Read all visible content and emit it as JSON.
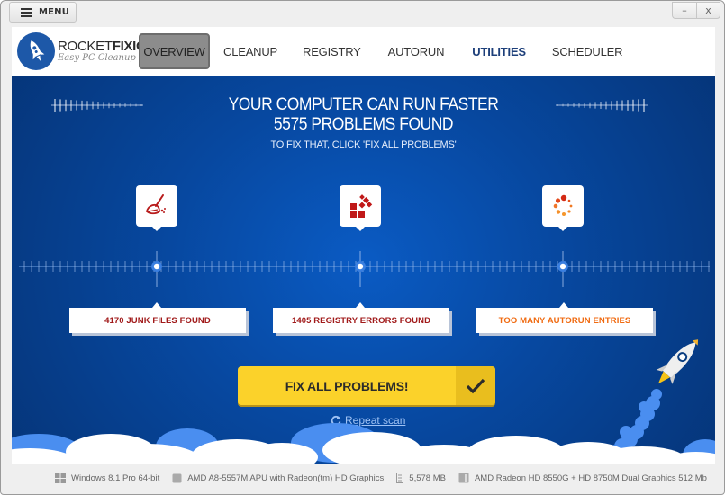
{
  "titlebar": {
    "menu_label": "MENU",
    "minimize_glyph": "–",
    "close_glyph": "x"
  },
  "brand": {
    "name_light": "ROCKET",
    "name_bold": "FIXIO",
    "tagline": "Easy PC Cleanup"
  },
  "nav": {
    "items": [
      {
        "label": "OVERVIEW",
        "state": "active"
      },
      {
        "label": "CLEANUP",
        "state": "normal"
      },
      {
        "label": "REGISTRY",
        "state": "normal"
      },
      {
        "label": "AUTORUN",
        "state": "normal"
      },
      {
        "label": "UTILITIES",
        "state": "highlight"
      },
      {
        "label": "SCHEDULER",
        "state": "normal"
      }
    ]
  },
  "headline": {
    "line1": "YOUR COMPUTER CAN RUN FASTER",
    "line2": "5575 PROBLEMS FOUND",
    "line3": "TO FIX THAT, CLICK 'FIX ALL PROBLEMS'"
  },
  "results": [
    {
      "icon": "broom-icon",
      "label": "4170 JUNK FILES FOUND",
      "color": "#a11a1a"
    },
    {
      "icon": "registry-blocks-icon",
      "label": "1405 REGISTRY ERRORS FOUND",
      "color": "#a11a1a"
    },
    {
      "icon": "spinner-dots-icon",
      "label": "TOO MANY AUTORUN ENTRIES",
      "color": "#f06a10"
    }
  ],
  "actions": {
    "fix_all_label": "FIX ALL PROBLEMS!",
    "repeat_scan_label": "Repeat scan"
  },
  "system_info": {
    "os": "Windows 8.1 Pro 64-bit",
    "cpu": "AMD A8-5557M APU with Radeon(tm) HD Graphics",
    "ram": "5,578 MB",
    "gpu": "AMD Radeon HD 8550G + HD 8750M Dual Graphics 512 Mb"
  },
  "colors": {
    "accent_blue": "#0a5bc4",
    "button_yellow": "#fbd22a",
    "error_red": "#a11a1a",
    "warning_orange": "#f06a10",
    "nav_highlight": "#1d3f7a"
  }
}
